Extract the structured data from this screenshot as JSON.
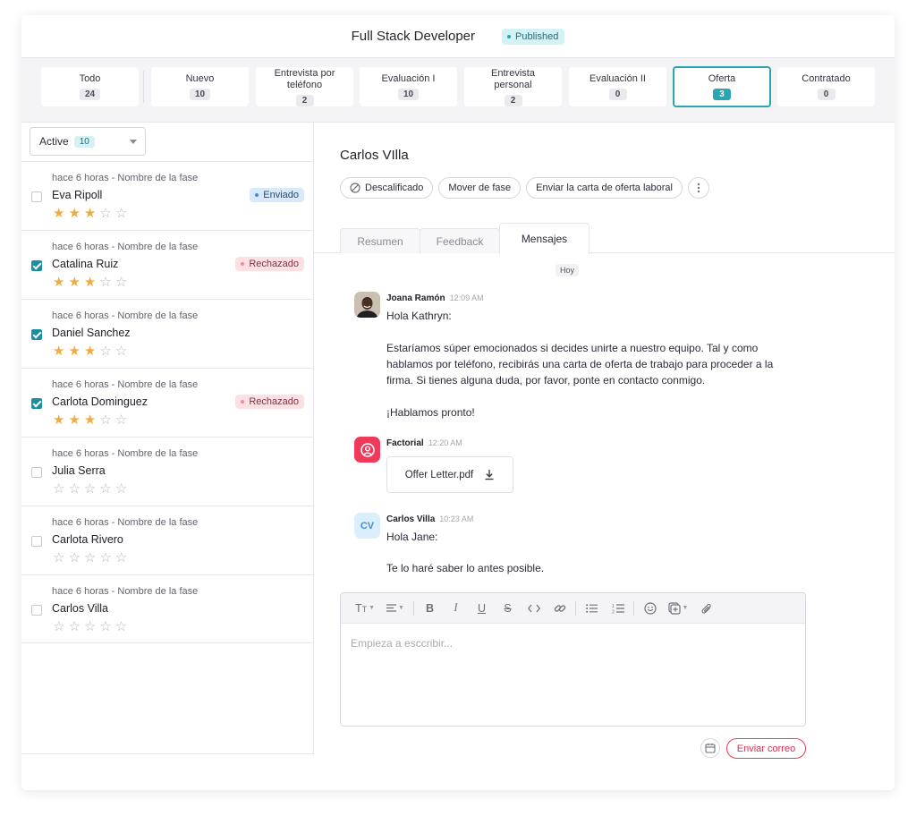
{
  "header": {
    "job_title": "Full Stack Developer",
    "status": "Published"
  },
  "stages": [
    {
      "label": "Todo",
      "count": "24"
    },
    {
      "label": "Nuevo",
      "count": "10"
    },
    {
      "label": "Entrevista por teléfono",
      "count": "2"
    },
    {
      "label": "Evaluación I",
      "count": "10"
    },
    {
      "label": "Entrevista personal",
      "count": "2"
    },
    {
      "label": "Evaluación II",
      "count": "0"
    },
    {
      "label": "Oferta",
      "count": "3"
    },
    {
      "label": "Contratado",
      "count": "0"
    }
  ],
  "active_stage": "Oferta",
  "filter": {
    "label": "Active",
    "count": "10"
  },
  "candidates": [
    {
      "meta": "hace 6 horas - Nombre de la fase",
      "name": "Eva Ripoll",
      "checked": false,
      "rating": 3,
      "badge": "Enviado"
    },
    {
      "meta": "hace 6 horas - Nombre de la fase",
      "name": "Catalina Ruiz",
      "checked": true,
      "rating": 3,
      "badge": "Rechazado"
    },
    {
      "meta": "hace 6 horas - Nombre de la fase",
      "name": "Daniel Sanchez",
      "checked": true,
      "rating": 3,
      "badge": ""
    },
    {
      "meta": "hace 6 horas - Nombre de la fase",
      "name": "Carlota Dominguez",
      "checked": true,
      "rating": 3,
      "badge": "Rechazado"
    },
    {
      "meta": "hace 6 horas - Nombre de la fase",
      "name": "Julia Serra",
      "checked": false,
      "rating": 0,
      "badge": ""
    },
    {
      "meta": "hace 6 horas - Nombre de la fase",
      "name": "Carlota Rivero",
      "checked": false,
      "rating": 0,
      "badge": ""
    },
    {
      "meta": "hace 6 horas - Nombre de la fase",
      "name": "Carlos Villa",
      "checked": false,
      "rating": 0,
      "badge": ""
    }
  ],
  "detail": {
    "name": "Carlos VIlla",
    "actions": {
      "disqualify": "Descalificado",
      "move": "Mover de fase",
      "send_offer": "Enviar la carta de oferta laboral"
    },
    "tabs": [
      "Resumen",
      "Feedback",
      "Mensajes"
    ],
    "active_tab": "Mensajes"
  },
  "messages": {
    "day": "Hoy",
    "m1": {
      "author": "Joana Ramón",
      "time": "12:09 AM",
      "greeting": "Hola Kathryn:",
      "line1": "Estaríamos súper emocionados si decides unirte a nuestro equipo. Tal y como hablamos por teléfono, recibirás una carta de oferta de trabajo para proceder a la firma. Si tienes alguna duda, por favor, ponte en contacto conmigo.",
      "line2": "¡Hablamos pronto!"
    },
    "m2": {
      "author": "Factorial",
      "time": "12:20 AM",
      "file": "Offer Letter.pdf"
    },
    "m3": {
      "author": "Carlos Villa",
      "time": "10:23 AM",
      "initials": "CV",
      "greeting": "Hola Jane:",
      "line1": "Te lo haré saber lo antes posible."
    }
  },
  "editor": {
    "placeholder": "Empieza a esccribir...",
    "send_label": "Enviar correo"
  },
  "colors": {
    "accent": "#2aa6b3",
    "brand": "#f03a5a",
    "star": "#f0ac3f"
  }
}
